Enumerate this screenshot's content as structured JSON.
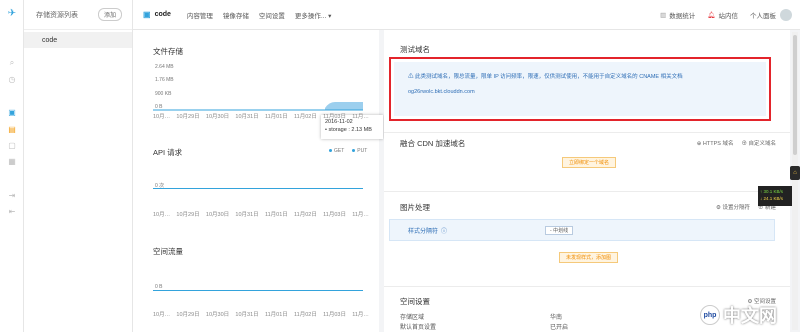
{
  "sidebar_rail": {
    "icons": [
      "logo-icon",
      "search-icon",
      "clock-icon",
      "storage-icon",
      "image-icon",
      "box-icon",
      "media-icon",
      "import-icon",
      "export-icon"
    ]
  },
  "sidebar": {
    "title": "存储资源列表",
    "add_label": "添加",
    "items": [
      {
        "label": "code"
      }
    ]
  },
  "topbar": {
    "bucket": "code",
    "tabs": [
      "内容管理",
      "镜像存储",
      "空间设置",
      "更多操作..."
    ],
    "right": {
      "stats": "数据统计",
      "messages": "站内信",
      "user": "个人面板"
    }
  },
  "storage_chart": {
    "title": "文件存储",
    "ylabels": [
      "2.64 MB",
      "1.76 MB",
      "900 KB",
      "0 B"
    ],
    "xlabels": [
      "10月…",
      "10月29日",
      "10月30日",
      "10月31日",
      "11月01日",
      "11月02日",
      "11月03日",
      "11月…"
    ],
    "tooltip_date": "2016-11-02",
    "tooltip_value": "• storage : 2.13 MB"
  },
  "api_chart": {
    "title": "API 请求",
    "legend": [
      "GET",
      "PUT"
    ],
    "ylabel": "0 次",
    "xlabels": [
      "10月…",
      "10月29日",
      "10月30日",
      "10月31日",
      "11月01日",
      "11月02日",
      "11月03日",
      "11月…"
    ]
  },
  "traffic_chart": {
    "title": "空间流量",
    "ylabel": "0 B",
    "xlabels": [
      "10月…",
      "10月29日",
      "10月30日",
      "10月31日",
      "11月01日",
      "11月02日",
      "11月03日",
      "11月…"
    ]
  },
  "test_domain": {
    "title": "测试域名",
    "warning": "此类测试域名，限总流量，限单 IP 访问频率，限速，仅供测试使用，不能用于自定义域名的 CNAME 相关文档",
    "domain": "og26rwolc.bkt.clouddn.com"
  },
  "cdn": {
    "title": "融合 CDN 加速域名",
    "https_link": "HTTPS 域名",
    "custom_link": "自定义域名",
    "button": "立即绑定一个域名"
  },
  "image": {
    "title": "图片处理",
    "settings_link": "设置分隔符",
    "new_link": "新建",
    "style_label": "样式分隔符",
    "style_value": "- 中划线",
    "button": "未发现样式，添加图"
  },
  "space": {
    "title": "空间设置",
    "settings_link": "空间设置",
    "region_key": "存储区域",
    "region_val": "华南",
    "index_key": "默认首页设置",
    "index_val": "已开启"
  },
  "net_widget": {
    "up": "30.1 KB/s",
    "down": "24.1 KB/s"
  },
  "watermark": "中文网",
  "colors": {
    "accent": "#33a3dc",
    "warn_border": "#e3242b",
    "domain_bg": "#eef5fc",
    "orange": "#f08c00"
  }
}
